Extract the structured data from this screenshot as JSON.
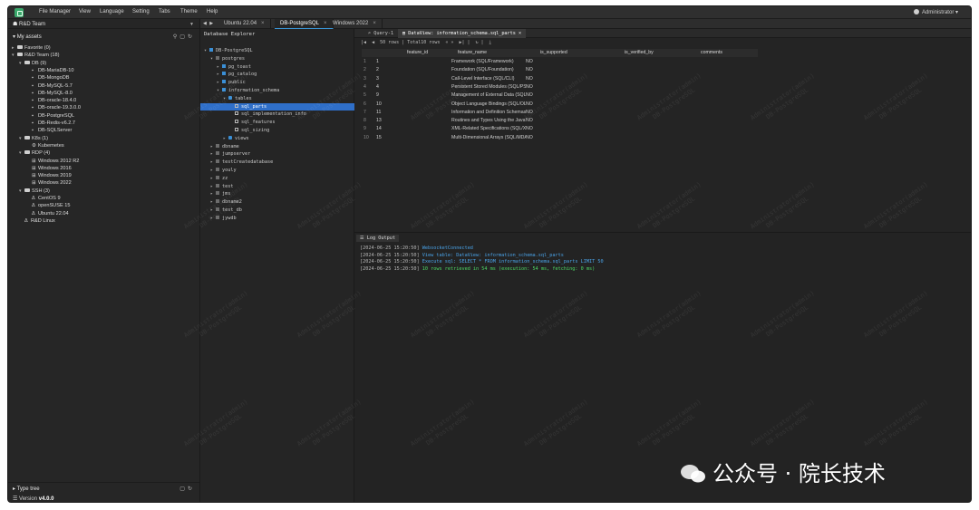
{
  "menu": [
    "File Manager",
    "View",
    "Language",
    "Setting",
    "Tabs",
    "Theme",
    "Help"
  ],
  "user": "Administrator",
  "sidebar": {
    "team": "R&D Team",
    "assets_label": "My assets",
    "tree": [
      {
        "label": "Favorite (0)",
        "depth": 0,
        "kind": "folder",
        "tw": "▸"
      },
      {
        "label": "R&D Team (18)",
        "depth": 0,
        "kind": "folder",
        "tw": "▾"
      },
      {
        "label": "DB (9)",
        "depth": 1,
        "kind": "folder",
        "tw": "▾"
      },
      {
        "label": "DB-MariaDB-10",
        "depth": 2,
        "kind": "db"
      },
      {
        "label": "DB-MongoDB",
        "depth": 2,
        "kind": "db"
      },
      {
        "label": "DB-MySQL-5.7",
        "depth": 2,
        "kind": "db"
      },
      {
        "label": "DB-MySQL-8.0",
        "depth": 2,
        "kind": "db"
      },
      {
        "label": "DB-oracle-18.4.0",
        "depth": 2,
        "kind": "db"
      },
      {
        "label": "DB-oracle-19.3.0.0",
        "depth": 2,
        "kind": "db"
      },
      {
        "label": "DB-PostgreSQL",
        "depth": 2,
        "kind": "db"
      },
      {
        "label": "DB-Redis-v6.2.7",
        "depth": 2,
        "kind": "db"
      },
      {
        "label": "DB-SQLServer",
        "depth": 2,
        "kind": "db"
      },
      {
        "label": "K8s (1)",
        "depth": 1,
        "kind": "folder",
        "tw": "▾"
      },
      {
        "label": "Kubernetes",
        "depth": 2,
        "kind": "k8s"
      },
      {
        "label": "RDP (4)",
        "depth": 1,
        "kind": "folder",
        "tw": "▾"
      },
      {
        "label": "Windows 2012 R2",
        "depth": 2,
        "kind": "win"
      },
      {
        "label": "Windows 2016",
        "depth": 2,
        "kind": "win"
      },
      {
        "label": "Windows 2019",
        "depth": 2,
        "kind": "win"
      },
      {
        "label": "Windows 2022",
        "depth": 2,
        "kind": "win"
      },
      {
        "label": "SSH (3)",
        "depth": 1,
        "kind": "folder",
        "tw": "▾"
      },
      {
        "label": "CentOS 9",
        "depth": 2,
        "kind": "linux"
      },
      {
        "label": "openSUSE 15",
        "depth": 2,
        "kind": "linux"
      },
      {
        "label": "Ubuntu 22.04",
        "depth": 2,
        "kind": "linux"
      },
      {
        "label": "R&D Linux",
        "depth": 1,
        "kind": "linux"
      }
    ],
    "type_tree": "Type tree",
    "version_label": "Version",
    "version": "v4.0.0"
  },
  "session_tabs": [
    {
      "label": "Ubuntu 22.04",
      "active": false
    },
    {
      "label": "DB-PostgreSQL",
      "active": true
    },
    {
      "label": "Windows 2022",
      "active": false
    }
  ],
  "explorer": {
    "title": "Database Explorer",
    "tree": [
      {
        "label": "DB-PostgreSQL",
        "depth": 0,
        "tw": "▾",
        "icon": "db"
      },
      {
        "label": "postgres",
        "depth": 1,
        "tw": "▾",
        "icon": "grey"
      },
      {
        "label": "pg_toast",
        "depth": 2,
        "tw": "▸",
        "icon": "blue"
      },
      {
        "label": "pg_catalog",
        "depth": 2,
        "tw": "▸",
        "icon": "blue"
      },
      {
        "label": "public",
        "depth": 2,
        "tw": "▸",
        "icon": "blue"
      },
      {
        "label": "information_schema",
        "depth": 2,
        "tw": "▾",
        "icon": "blue"
      },
      {
        "label": "tables",
        "depth": 3,
        "tw": "▾",
        "icon": "fld"
      },
      {
        "label": "sql_parts",
        "depth": 4,
        "tw": "",
        "icon": "tbl",
        "selected": true
      },
      {
        "label": "sql_implementation_info",
        "depth": 4,
        "tw": "",
        "icon": "tbl"
      },
      {
        "label": "sql_features",
        "depth": 4,
        "tw": "",
        "icon": "tbl"
      },
      {
        "label": "sql_sizing",
        "depth": 4,
        "tw": "",
        "icon": "tbl"
      },
      {
        "label": "views",
        "depth": 3,
        "tw": "▸",
        "icon": "fld"
      },
      {
        "label": "dbname",
        "depth": 1,
        "tw": "▸",
        "icon": "grey"
      },
      {
        "label": "jumpserver",
        "depth": 1,
        "tw": "▸",
        "icon": "grey"
      },
      {
        "label": "testCreatedatabase",
        "depth": 1,
        "tw": "▸",
        "icon": "grey"
      },
      {
        "label": "youly",
        "depth": 1,
        "tw": "▸",
        "icon": "grey"
      },
      {
        "label": "zz",
        "depth": 1,
        "tw": "▸",
        "icon": "grey"
      },
      {
        "label": "test",
        "depth": 1,
        "tw": "▸",
        "icon": "grey"
      },
      {
        "label": "jms",
        "depth": 1,
        "tw": "▸",
        "icon": "grey"
      },
      {
        "label": "dbname2",
        "depth": 1,
        "tw": "▸",
        "icon": "grey"
      },
      {
        "label": "test_db",
        "depth": 1,
        "tw": "▸",
        "icon": "grey"
      },
      {
        "label": "jywdb",
        "depth": 1,
        "tw": "▸",
        "icon": "grey"
      }
    ]
  },
  "query_tabs": [
    {
      "label": "Query-1",
      "active": false
    },
    {
      "label": "DataView: information_schema.sql_parts",
      "active": true
    }
  ],
  "toolbar": {
    "rows": "50 rows",
    "total": "Total10 rows"
  },
  "grid": {
    "columns": [
      "feature_id",
      "feature_name",
      "is_supported",
      "is_verified_by",
      "comments"
    ],
    "rows": [
      [
        "1",
        "1",
        "Framework (SQL/Framework)",
        "NO",
        "",
        ""
      ],
      [
        "2",
        "2",
        "Foundation (SQL/Foundation)",
        "NO",
        "",
        ""
      ],
      [
        "3",
        "3",
        "Call-Level Interface (SQL/CLI)",
        "NO",
        "",
        ""
      ],
      [
        "4",
        "4",
        "Persistent Stored Modules (SQL/PSM)",
        "NO",
        "",
        ""
      ],
      [
        "5",
        "9",
        "Management of External Data (SQL/MED)",
        "NO",
        "",
        ""
      ],
      [
        "6",
        "10",
        "Object Language Bindings (SQL/OLB)",
        "NO",
        "",
        ""
      ],
      [
        "7",
        "11",
        "Information and Definition Schemas (SQL/Schemata)",
        "NO",
        "",
        ""
      ],
      [
        "8",
        "13",
        "Routines and Types Using the Java Programming Language (SQL/JRT)",
        "NO",
        "",
        ""
      ],
      [
        "9",
        "14",
        "XML-Related Specifications (SQL/XML)",
        "NO",
        "",
        ""
      ],
      [
        "10",
        "15",
        "Multi-Dimensional Arrays (SQL/MDA)",
        "NO",
        "",
        ""
      ]
    ]
  },
  "log": {
    "title": "Log Output",
    "lines": [
      {
        "ts": "[2024-06-25 15:20:50]",
        "msg": "WebsocketConnected",
        "color": "#4aa3e8"
      },
      {
        "ts": "[2024-06-25 15:20:50]",
        "msg": "View table: DataView: information_schema.sql_parts",
        "color": "#4aa3e8"
      },
      {
        "ts": "[2024-06-25 15:20:50]",
        "msg": "Execute sql: SELECT * FROM information_schema.sql_parts LIMIT 50",
        "color": "#4aa3e8"
      },
      {
        "ts": "[2024-06-25 15:20:50]",
        "msg": "10 rows retrieved in 54 ms (execution: 54 ms, fetching: 0 ms)",
        "color": "#4cd964"
      }
    ]
  },
  "watermark": [
    "Administrator(admin)",
    "DB-PostgreSQL"
  ],
  "brand": "公众号 · 院长技术"
}
